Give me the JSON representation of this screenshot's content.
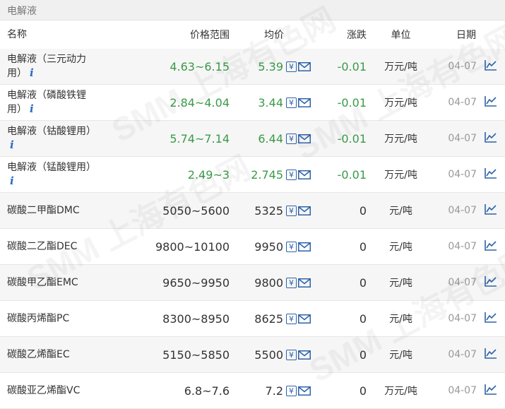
{
  "panel_title": "电解液",
  "headers": {
    "name": "名称",
    "range": "价格范围",
    "avg": "均价",
    "change": "涨跌",
    "unit": "单位",
    "date": "日期"
  },
  "info_mark": "i",
  "yen_icon": "¥",
  "colors": {
    "positive_text": "#3a9a48",
    "accent_blue": "#2d62a8",
    "info_blue": "#2a6cc2"
  },
  "rows": [
    {
      "name_line1": "电解液（三元动力",
      "name_line2": "用）",
      "range": "4.63~6.15",
      "avg": "5.39",
      "change": "-0.01",
      "unit": "万元/吨",
      "date": "04-07"
    },
    {
      "name_line1": "电解液（磷酸铁锂",
      "name_line2": "用）",
      "range": "2.84~4.04",
      "avg": "3.44",
      "change": "-0.01",
      "unit": "万元/吨",
      "date": "04-07"
    },
    {
      "name_line1": "电解液（钴酸锂用）",
      "name_line2": "",
      "range": "5.74~7.14",
      "avg": "6.44",
      "change": "-0.01",
      "unit": "万元/吨",
      "date": "04-07"
    },
    {
      "name_line1": "电解液（锰酸锂用）",
      "name_line2": "",
      "range": "2.49~3",
      "avg": "2.745",
      "change": "-0.01",
      "unit": "万元/吨",
      "date": "04-07"
    },
    {
      "name_line1": "碳酸二甲酯DMC",
      "name_line2": "",
      "range": "5050~5600",
      "avg": "5325",
      "change": "0",
      "unit": "元/吨",
      "date": "04-07"
    },
    {
      "name_line1": "碳酸二乙酯DEC",
      "name_line2": "",
      "range": "9800~10100",
      "avg": "9950",
      "change": "0",
      "unit": "元/吨",
      "date": "04-07"
    },
    {
      "name_line1": "碳酸甲乙酯EMC",
      "name_line2": "",
      "range": "9650~9950",
      "avg": "9800",
      "change": "0",
      "unit": "元/吨",
      "date": "04-07"
    },
    {
      "name_line1": "碳酸丙烯酯PC",
      "name_line2": "",
      "range": "8300~8950",
      "avg": "8625",
      "change": "0",
      "unit": "元/吨",
      "date": "04-07"
    },
    {
      "name_line1": "碳酸乙烯酯EC",
      "name_line2": "",
      "range": "5150~5850",
      "avg": "5500",
      "change": "0",
      "unit": "元/吨",
      "date": "04-07"
    },
    {
      "name_line1": "碳酸亚乙烯酯VC",
      "name_line2": "",
      "range": "6.8~7.6",
      "avg": "7.2",
      "change": "0",
      "unit": "万元/吨",
      "date": "04-07"
    }
  ],
  "watermark_text": "SMM 上海有色网"
}
